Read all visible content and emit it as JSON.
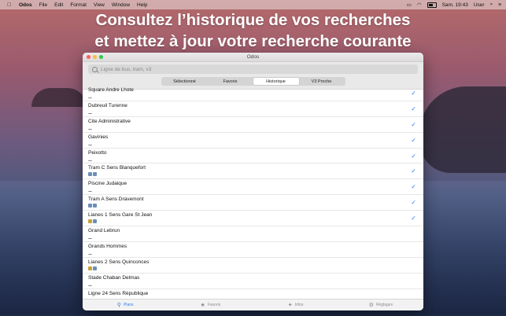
{
  "menubar": {
    "apple": "",
    "items": [
      "Odos",
      "File",
      "Edit",
      "Format",
      "View",
      "Window",
      "Help"
    ],
    "clock": "Sam. 19:43",
    "user": "User"
  },
  "headline": {
    "line1": "Consultez l’historique de vos recherches",
    "line2": "et mettez à jour votre recherche courante"
  },
  "window": {
    "title": "Odos",
    "search_placeholder": "Ligne de bus, tram, v3",
    "segments": [
      "Sélectionné",
      "Favoris",
      "Historique",
      "V3 Proche"
    ],
    "active_segment": "Historique",
    "rows": [
      {
        "name": "Square Andre Lhote",
        "modes": [
          "walk"
        ],
        "checked": true
      },
      {
        "name": "Dubreuil Turenne",
        "modes": [
          "walk"
        ],
        "checked": true
      },
      {
        "name": "Cite Administrative",
        "modes": [
          "walk"
        ],
        "checked": true
      },
      {
        "name": "Gavinies",
        "modes": [
          "walk"
        ],
        "checked": true
      },
      {
        "name": "Peixotto",
        "modes": [
          "walk"
        ],
        "checked": true
      },
      {
        "name": "Tram C Sens Blanquefort",
        "modes": [
          "tram",
          "tram"
        ],
        "checked": true
      },
      {
        "name": "Piscine Judaique",
        "modes": [
          "walk"
        ],
        "checked": true
      },
      {
        "name": "Tram A Sens Dravemont",
        "modes": [
          "tram",
          "tram"
        ],
        "checked": true
      },
      {
        "name": "Lianes 1 Sens Gare St Jean",
        "modes": [
          "bus",
          "tram"
        ],
        "checked": true
      },
      {
        "name": "Grand Lebrun",
        "modes": [
          "walk"
        ],
        "checked": false
      },
      {
        "name": "Grands Hommes",
        "modes": [
          "walk"
        ],
        "checked": false
      },
      {
        "name": "Lianes 2 Sens Quinconces",
        "modes": [
          "bus",
          "tram"
        ],
        "checked": false
      },
      {
        "name": "Stade Chaban Delmas",
        "modes": [
          "walk"
        ],
        "checked": false
      },
      {
        "name": "Ligne 24 Sens République",
        "modes": [],
        "checked": false
      }
    ],
    "tabs": [
      {
        "label": "Plans",
        "icon": "map-pin-icon",
        "active": true
      },
      {
        "label": "Favoris",
        "icon": "star-icon",
        "active": false
      },
      {
        "label": "Infos",
        "icon": "bird-icon",
        "active": false
      },
      {
        "label": "Réglages",
        "icon": "gear-icon",
        "active": false
      }
    ]
  },
  "colors": {
    "accent": "#2e7cf6"
  }
}
